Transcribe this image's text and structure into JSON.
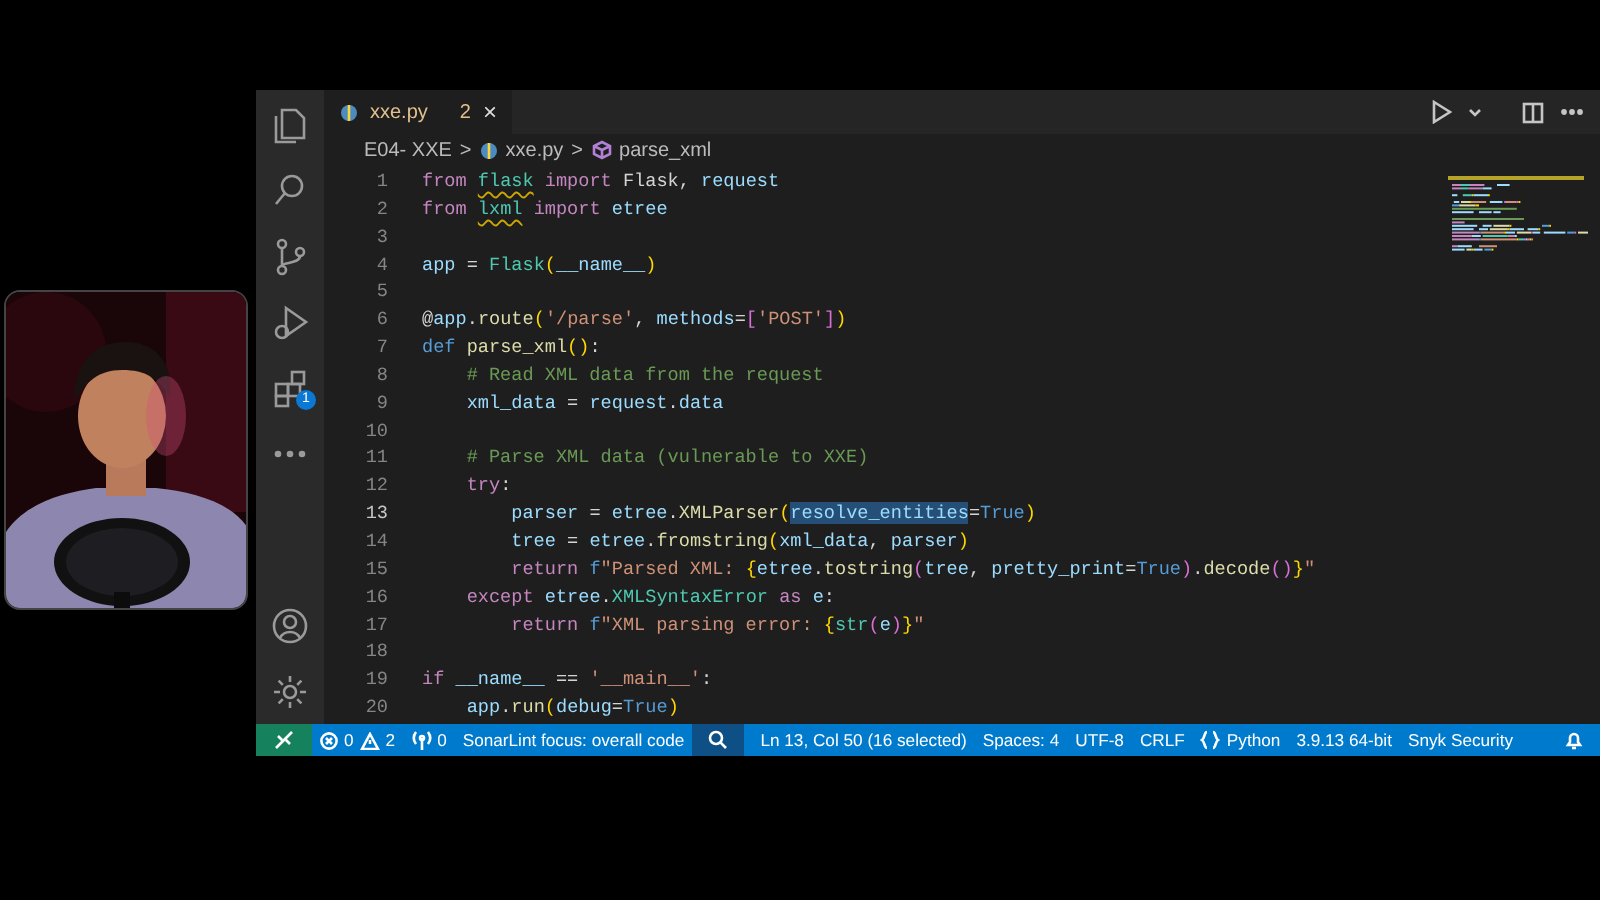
{
  "activity_bar": [
    {
      "kind": "explorer"
    },
    {
      "kind": "search"
    },
    {
      "kind": "source_control"
    },
    {
      "kind": "run_debug"
    },
    {
      "kind": "extensions",
      "badge": "1"
    },
    {
      "kind": "more"
    },
    {
      "kind": "spacer"
    },
    {
      "kind": "accounts"
    },
    {
      "kind": "settings"
    }
  ],
  "editor_tab": {
    "filename": "xxe.py",
    "problems": "2",
    "close": "×"
  },
  "breadcrumb": {
    "separator": ">",
    "items": [
      {
        "text": "E04- XXE",
        "kind": "folder"
      },
      {
        "text": "xxe.py",
        "kind": "file"
      },
      {
        "text": "parse_xml",
        "kind": "symbol"
      }
    ]
  },
  "code_lines": [
    {
      "number": "1",
      "current": false,
      "tokens": [
        {
          "text": "from ",
          "kind": "keyword"
        },
        {
          "text": "flask",
          "kind": "module_warning"
        },
        {
          "text": " import ",
          "kind": "keyword"
        },
        {
          "text": "Flask, ",
          "kind": "punctuation"
        },
        {
          "text": "request",
          "kind": "variable"
        }
      ]
    },
    {
      "number": "2",
      "current": false,
      "tokens": [
        {
          "text": "from ",
          "kind": "keyword"
        },
        {
          "text": "lxml",
          "kind": "module_warning"
        },
        {
          "text": " import ",
          "kind": "keyword"
        },
        {
          "text": "etree",
          "kind": "variable"
        }
      ]
    },
    {
      "number": "3",
      "current": false
    },
    {
      "number": "4",
      "current": false,
      "tokens": [
        {
          "text": "app",
          "kind": "variable"
        },
        {
          "text": " = ",
          "kind": "punctuation"
        },
        {
          "text": "Flask",
          "kind": "class"
        },
        {
          "text": "(",
          "kind": "bracket"
        },
        {
          "text": "__name__",
          "kind": "variable"
        },
        {
          "text": ")",
          "kind": "bracket"
        }
      ]
    },
    {
      "number": "5",
      "current": false
    },
    {
      "number": "6",
      "current": false,
      "tokens": [
        {
          "text": "@",
          "kind": "punctuation"
        },
        {
          "text": "app",
          "kind": "variable"
        },
        {
          "text": ".",
          "kind": "punctuation"
        },
        {
          "text": "route",
          "kind": "function"
        },
        {
          "text": "(",
          "kind": "bracket"
        },
        {
          "text": "'/parse'",
          "kind": "string"
        },
        {
          "text": ", ",
          "kind": "punctuation"
        },
        {
          "text": "methods",
          "kind": "variable"
        },
        {
          "text": "=",
          "kind": "punctuation"
        },
        {
          "text": "[",
          "kind": "bracket2"
        },
        {
          "text": "'POST'",
          "kind": "string"
        },
        {
          "text": "]",
          "kind": "bracket2"
        },
        {
          "text": ")",
          "kind": "bracket"
        }
      ]
    },
    {
      "number": "7",
      "current": false,
      "tokens": [
        {
          "text": "def ",
          "kind": "storage"
        },
        {
          "text": "parse_xml",
          "kind": "function"
        },
        {
          "text": "()",
          "kind": "bracket"
        },
        {
          "text": ":",
          "kind": "punctuation"
        }
      ]
    },
    {
      "number": "8",
      "current": false,
      "tokens": [
        {
          "text": "    # Read XML data from the request",
          "kind": "comment"
        }
      ]
    },
    {
      "number": "9",
      "current": false,
      "tokens": [
        {
          "text": "    xml_data",
          "kind": "variable"
        },
        {
          "text": " = ",
          "kind": "punctuation"
        },
        {
          "text": "request",
          "kind": "variable"
        },
        {
          "text": ".",
          "kind": "punctuation"
        },
        {
          "text": "data",
          "kind": "variable"
        }
      ]
    },
    {
      "number": "10",
      "current": false
    },
    {
      "number": "11",
      "current": false,
      "tokens": [
        {
          "text": "    # Parse XML data (vulnerable to XXE)",
          "kind": "comment"
        }
      ]
    },
    {
      "number": "12",
      "current": false,
      "tokens": [
        {
          "text": "    try",
          "kind": "keyword"
        },
        {
          "text": ":",
          "kind": "punctuation"
        }
      ]
    },
    {
      "number": "13",
      "current": true,
      "tokens": [
        {
          "text": "        parser",
          "kind": "variable"
        },
        {
          "text": " = ",
          "kind": "punctuation"
        },
        {
          "text": "etree",
          "kind": "variable"
        },
        {
          "text": ".",
          "kind": "punctuation"
        },
        {
          "text": "XMLParser",
          "kind": "function"
        },
        {
          "text": "(",
          "kind": "bracket"
        },
        {
          "text": "resolve_entities",
          "kind": "selected_variable"
        },
        {
          "text": "=",
          "kind": "punctuation"
        },
        {
          "text": "True",
          "kind": "storage"
        },
        {
          "text": ")",
          "kind": "bracket"
        }
      ]
    },
    {
      "number": "14",
      "current": false,
      "tokens": [
        {
          "text": "        tree",
          "kind": "variable"
        },
        {
          "text": " = ",
          "kind": "punctuation"
        },
        {
          "text": "etree",
          "kind": "variable"
        },
        {
          "text": ".",
          "kind": "punctuation"
        },
        {
          "text": "fromstring",
          "kind": "function"
        },
        {
          "text": "(",
          "kind": "bracket"
        },
        {
          "text": "xml_data",
          "kind": "variable"
        },
        {
          "text": ", ",
          "kind": "punctuation"
        },
        {
          "text": "parser",
          "kind": "variable"
        },
        {
          "text": ")",
          "kind": "bracket"
        }
      ]
    },
    {
      "number": "15",
      "current": false,
      "tokens": [
        {
          "text": "        return ",
          "kind": "keyword"
        },
        {
          "text": "f",
          "kind": "storage"
        },
        {
          "text": "\"Parsed XML: ",
          "kind": "string"
        },
        {
          "text": "{",
          "kind": "bracket"
        },
        {
          "text": "etree",
          "kind": "variable"
        },
        {
          "text": ".",
          "kind": "punctuation"
        },
        {
          "text": "tostring",
          "kind": "function"
        },
        {
          "text": "(",
          "kind": "bracket2"
        },
        {
          "text": "tree",
          "kind": "variable"
        },
        {
          "text": ", ",
          "kind": "punctuation"
        },
        {
          "text": "pretty_print",
          "kind": "variable"
        },
        {
          "text": "=",
          "kind": "punctuation"
        },
        {
          "text": "True",
          "kind": "storage"
        },
        {
          "text": ")",
          "kind": "bracket2"
        },
        {
          "text": ".",
          "kind": "punctuation"
        },
        {
          "text": "decode",
          "kind": "function"
        },
        {
          "text": "()",
          "kind": "bracket2"
        },
        {
          "text": "}",
          "kind": "bracket"
        },
        {
          "text": "\"",
          "kind": "string"
        }
      ]
    },
    {
      "number": "16",
      "current": false,
      "tokens": [
        {
          "text": "    except ",
          "kind": "keyword"
        },
        {
          "text": "etree",
          "kind": "variable"
        },
        {
          "text": ".",
          "kind": "punctuation"
        },
        {
          "text": "XMLSyntaxError",
          "kind": "class"
        },
        {
          "text": " as ",
          "kind": "keyword"
        },
        {
          "text": "e",
          "kind": "variable"
        },
        {
          "text": ":",
          "kind": "punctuation"
        }
      ]
    },
    {
      "number": "17",
      "current": false,
      "tokens": [
        {
          "text": "        return ",
          "kind": "keyword"
        },
        {
          "text": "f",
          "kind": "storage"
        },
        {
          "text": "\"XML parsing error: ",
          "kind": "string"
        },
        {
          "text": "{",
          "kind": "bracket"
        },
        {
          "text": "str",
          "kind": "class"
        },
        {
          "text": "(",
          "kind": "bracket2"
        },
        {
          "text": "e",
          "kind": "variable"
        },
        {
          "text": ")",
          "kind": "bracket2"
        },
        {
          "text": "}",
          "kind": "bracket"
        },
        {
          "text": "\"",
          "kind": "string"
        }
      ]
    },
    {
      "number": "18",
      "current": false
    },
    {
      "number": "19",
      "current": false,
      "tokens": [
        {
          "text": "if ",
          "kind": "keyword"
        },
        {
          "text": "__name__",
          "kind": "variable"
        },
        {
          "text": " == ",
          "kind": "punctuation"
        },
        {
          "text": "'__main__'",
          "kind": "string"
        },
        {
          "text": ":",
          "kind": "punctuation"
        }
      ]
    },
    {
      "number": "20",
      "current": false,
      "tokens": [
        {
          "text": "    app",
          "kind": "variable"
        },
        {
          "text": ".",
          "kind": "punctuation"
        },
        {
          "text": "run",
          "kind": "function"
        },
        {
          "text": "(",
          "kind": "bracket"
        },
        {
          "text": "debug",
          "kind": "variable"
        },
        {
          "text": "=",
          "kind": "punctuation"
        },
        {
          "text": "True",
          "kind": "storage"
        },
        {
          "text": ")",
          "kind": "bracket"
        }
      ]
    }
  ],
  "status_bar": [
    {
      "kind": "remote"
    },
    {
      "kind": "problems",
      "errors": "0",
      "warnings": "2"
    },
    {
      "kind": "ports",
      "text": "0"
    },
    {
      "kind": "text",
      "text": "SonarLint focus: overall code"
    },
    {
      "kind": "search"
    },
    {
      "kind": "text",
      "text": "Ln 13, Col 50 (16 selected)"
    },
    {
      "kind": "text",
      "text": "Spaces: 4"
    },
    {
      "kind": "text",
      "text": "UTF-8"
    },
    {
      "kind": "text",
      "text": "CRLF"
    },
    {
      "kind": "language",
      "text": "Python"
    },
    {
      "kind": "text",
      "text": "3.9.13 64-bit"
    },
    {
      "kind": "text",
      "text": "Snyk Security"
    },
    {
      "kind": "bell"
    }
  ]
}
